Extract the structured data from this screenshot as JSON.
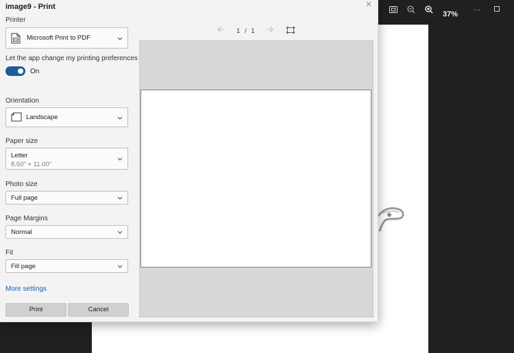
{
  "viewer": {
    "zoom": "37%",
    "toolbar_icons": [
      "fit-page-icon",
      "zoom-out-icon",
      "zoom-in-icon"
    ],
    "more_icon": "more-icon",
    "maximize_icon": "maximize-icon"
  },
  "dialog": {
    "title": "image9 - Print",
    "close_icon": "close-icon"
  },
  "printer": {
    "label": "Printer",
    "value": "Microsoft Print to PDF",
    "icon": "printer-icon"
  },
  "app_prefs": {
    "label": "Let the app change my printing preferences",
    "state": "On",
    "enabled": true
  },
  "orientation": {
    "label": "Orientation",
    "value": "Landscape",
    "icon": "page-icon"
  },
  "paper_size": {
    "label": "Paper size",
    "value": "Letter",
    "detail": "8.50\" × 11.00\""
  },
  "photo_size": {
    "label": "Photo size",
    "value": "Full page"
  },
  "page_margins": {
    "label": "Page Margins",
    "value": "Normal"
  },
  "fit": {
    "label": "Fit",
    "value": "Fill page"
  },
  "more_settings": "More settings",
  "buttons": {
    "print": "Print",
    "cancel": "Cancel"
  },
  "preview": {
    "current_page": "1",
    "total_pages": "1",
    "page_separator": "/",
    "prev_icon": "arrow-left-icon",
    "next_icon": "arrow-right-icon",
    "fit_icon": "fit-screen-icon"
  },
  "colors": {
    "accent": "#1e5a9c",
    "link": "#1a5fb4",
    "dialog_bg": "#f3f3f3",
    "viewer_bg": "#202020"
  }
}
